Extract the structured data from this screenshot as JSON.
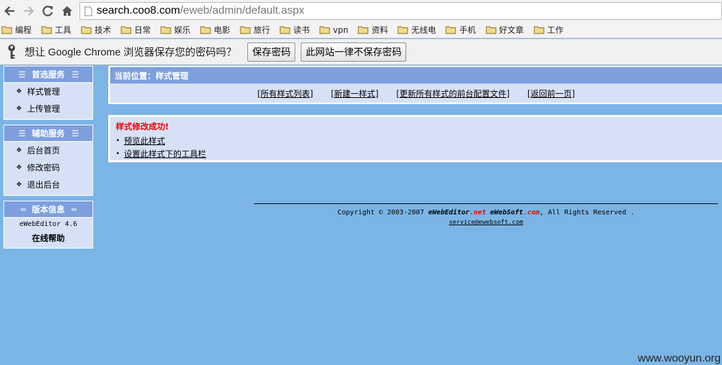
{
  "browser": {
    "url_host": "search.coo8.com",
    "url_path": "/eweb/admin/default.aspx"
  },
  "bookmarks": [
    "编程",
    "工具",
    "技术",
    "日常",
    "娱乐",
    "电影",
    "旅行",
    "读书",
    "vpn",
    "资料",
    "无线电",
    "手机",
    "好文章",
    "工作"
  ],
  "infobar": {
    "message": "想让 Google Chrome 浏览器保存您的密码吗？",
    "save_label": "保存密码",
    "never_label": "此网站一律不保存密码"
  },
  "sidebar": {
    "panels": [
      {
        "title": "首选服务",
        "items": [
          "样式管理",
          "上传管理"
        ]
      },
      {
        "title": "辅助服务",
        "items": [
          "后台首页",
          "修改密码",
          "退出后台"
        ]
      },
      {
        "title": "版本信息",
        "version": "eWebEditor 4.6",
        "help": "在线帮助"
      }
    ]
  },
  "location": {
    "title": "当前位置：样式管理",
    "links": [
      "所有样式列表",
      "新建一样式",
      "更新所有样式的前台配置文件",
      "返回前一页"
    ]
  },
  "result": {
    "success": "样式修改成功!",
    "links": [
      "预览此样式",
      "设置此样式下的工具栏"
    ]
  },
  "footer": {
    "copyright_prefix": "Copyright © 2003-2007 ",
    "brand1_a": "eWebEditor",
    "brand1_b": ".net",
    "brand2_a": " eWebSoft",
    "brand2_b": ".com",
    "copyright_suffix": ", All Rights Reserved .",
    "email": "service@ewebsoft.com"
  },
  "watermark": "www.wooyun.org"
}
